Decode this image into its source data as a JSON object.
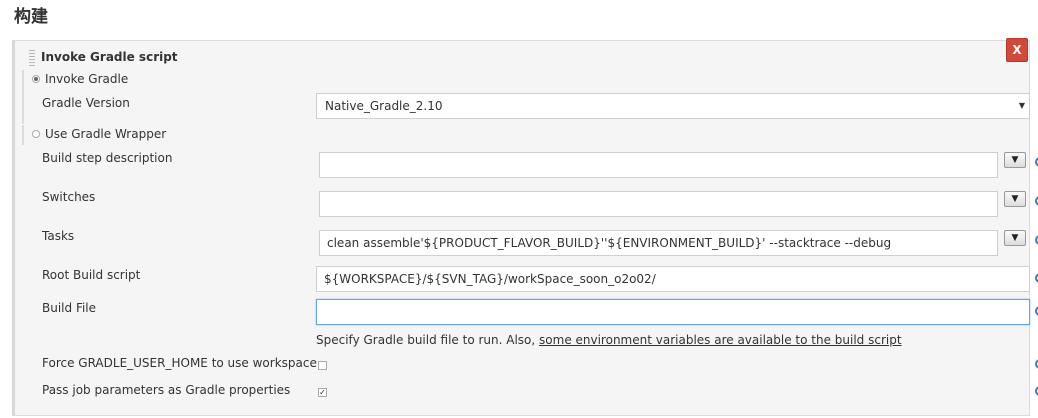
{
  "section": {
    "title": "构建"
  },
  "step": {
    "title": "Invoke Gradle script",
    "close_label": "X"
  },
  "options": {
    "invoke_gradle": "Invoke Gradle",
    "use_wrapper": "Use Gradle Wrapper"
  },
  "fields": {
    "gradle_version": {
      "label": "Gradle Version",
      "value": "Native_Gradle_2.10"
    },
    "build_step_description": {
      "label": "Build step description",
      "value": ""
    },
    "switches": {
      "label": "Switches",
      "value": ""
    },
    "tasks": {
      "label": "Tasks",
      "value": "clean  assemble'${PRODUCT_FLAVOR_BUILD}''${ENVIRONMENT_BUILD}'  --stacktrace --debug"
    },
    "root_build_script": {
      "label": "Root Build script",
      "value": "${WORKSPACE}/${SVN_TAG}/workSpace_soon_o2o02/"
    },
    "build_file": {
      "label": "Build File",
      "value": "",
      "hint_prefix": "Specify Gradle build file to run. Also, ",
      "hint_link": "some environment variables are available to the build script"
    },
    "force_user_home": {
      "label": "Force GRADLE_USER_HOME to use workspace",
      "checked": false
    },
    "pass_job_params": {
      "label": "Pass job parameters as Gradle properties",
      "checked": true
    }
  },
  "icons": {
    "expand": "expand-down-icon",
    "help": "help-icon",
    "grip": "drag-grip-icon"
  },
  "colors": {
    "close_button": "#d24939",
    "help_icon": "#3f79c6",
    "focus_border": "#66a3e0"
  }
}
